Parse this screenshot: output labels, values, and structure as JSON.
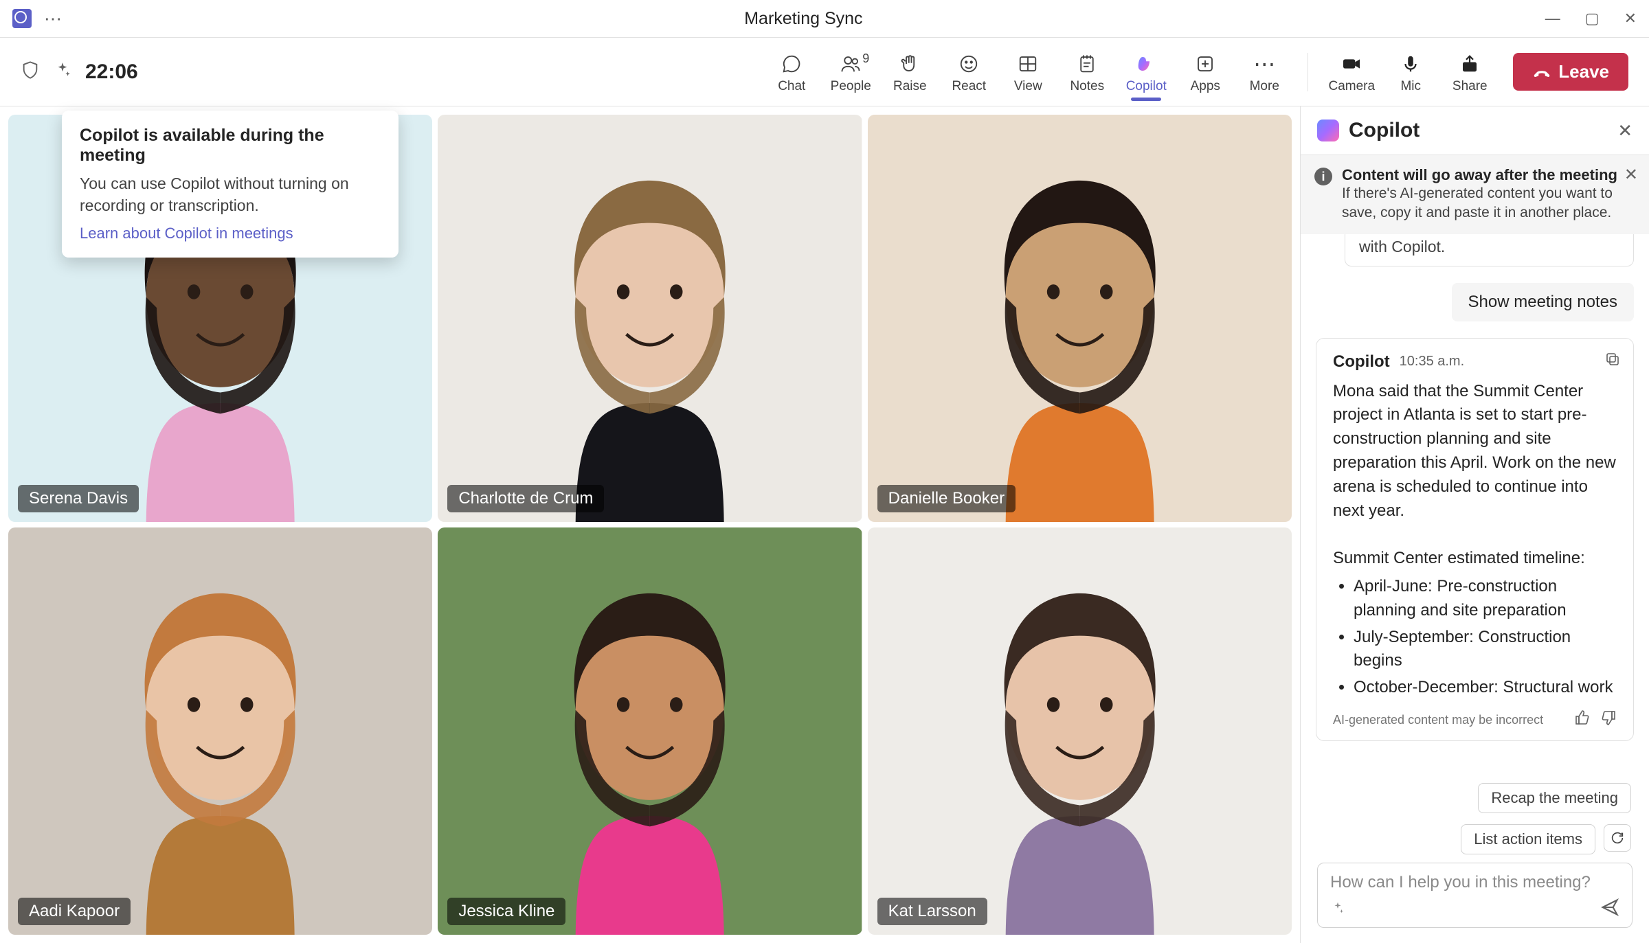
{
  "window": {
    "title": "Marketing Sync"
  },
  "toolbar_left": {
    "timer": "22:06"
  },
  "actions": {
    "chat": "Chat",
    "people": "People",
    "people_count": "9",
    "raise": "Raise",
    "react": "React",
    "view": "View",
    "notes": "Notes",
    "copilot": "Copilot",
    "apps": "Apps",
    "more": "More",
    "camera": "Camera",
    "mic": "Mic",
    "share": "Share",
    "leave": "Leave"
  },
  "tooltip": {
    "title": "Copilot is available during the meeting",
    "body": "You can use Copilot without turning on recording or transcription.",
    "link": "Learn about Copilot in meetings"
  },
  "participants": [
    {
      "name": "Serena Davis",
      "bg": "#dceef2",
      "skin": "#6a4a33",
      "hair": "#1c1412",
      "shirt": "#e8a6cc"
    },
    {
      "name": "Charlotte de Crum",
      "bg": "#ece9e4",
      "skin": "#e8c6ad",
      "hair": "#8a6a42",
      "shirt": "#15151a"
    },
    {
      "name": "Danielle Booker",
      "bg": "#eaddcd",
      "skin": "#caa074",
      "hair": "#221713",
      "shirt": "#e07a2e"
    },
    {
      "name": "Aadi Kapoor",
      "bg": "#cfc7be",
      "skin": "#e9c4a6",
      "hair": "#c27a3e",
      "shirt": "#b47a39"
    },
    {
      "name": "Jessica Kline",
      "bg": "#6e8f58",
      "skin": "#c98f63",
      "hair": "#2a1d16",
      "shirt": "#e83a8c"
    },
    {
      "name": "Kat Larsson",
      "bg": "#eeece8",
      "skin": "#e7c3a9",
      "hair": "#3a2a22",
      "shirt": "#8f7aa3"
    }
  ],
  "panel": {
    "title": "Copilot",
    "banner_title": "Content will go away after the meeting",
    "banner_body": "If there's AI-generated content you want to save, copy it and paste it in another place.",
    "peek_text": "with Copilot.",
    "show_notes": "Show meeting notes",
    "message": {
      "name": "Copilot",
      "time": "10:35 a.m.",
      "body_p1": "Mona said that the Summit Center project in Atlanta is set to start pre-construction planning and site preparation this April. Work on the new arena is scheduled to continue into next year.",
      "body_p2": "Summit Center estimated timeline:",
      "bullet1": "April-June: Pre-construction planning and site preparation",
      "bullet2": "July-September: Construction begins",
      "bullet3": "October-December: Structural work",
      "disclaimer": "AI-generated content may be incorrect"
    },
    "suggestions": {
      "recap": "Recap the meeting",
      "actions": "List action items"
    },
    "composer_placeholder": "How can I help you in this meeting?"
  }
}
